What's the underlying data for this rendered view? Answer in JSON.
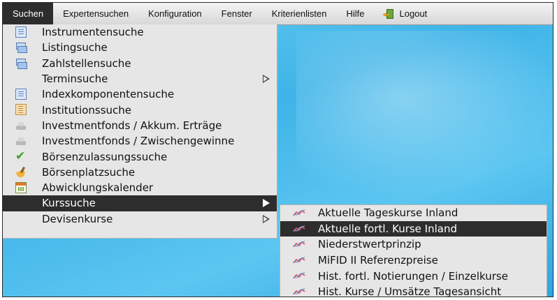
{
  "menubar": {
    "items": [
      {
        "label": "Suchen"
      },
      {
        "label": "Expertensuchen"
      },
      {
        "label": "Konfiguration"
      },
      {
        "label": "Fenster"
      },
      {
        "label": "Kriterienlisten"
      },
      {
        "label": "Hilfe"
      }
    ],
    "logout_label": "Logout"
  },
  "search_menu": {
    "items": [
      {
        "label": "Instrumentensuche",
        "icon": "document-list-icon"
      },
      {
        "label": "Listingsuche",
        "icon": "stacked-windows-icon"
      },
      {
        "label": "Zahlstellensuche",
        "icon": "stacked-windows-icon"
      },
      {
        "label": "Terminsuche",
        "icon": "",
        "submenu_arrow": "hollow"
      },
      {
        "label": "Indexkomponentensuche",
        "icon": "document-list-icon"
      },
      {
        "label": "Institutionssuche",
        "icon": "ledger-book-icon"
      },
      {
        "label": "Investmentfonds / Akkum. Erträge",
        "icon": "coin-pile-icon"
      },
      {
        "label": "Investmentfonds / Zwischengewinne",
        "icon": "coin-pile-icon"
      },
      {
        "label": "Börsenzulassungssuche",
        "icon": "checkmark-icon"
      },
      {
        "label": "Börsenplatzsuche",
        "icon": "broom-icon"
      },
      {
        "label": "Abwicklungskalender",
        "icon": "calendar-icon"
      },
      {
        "label": "Kurssuche",
        "icon": "",
        "submenu_arrow": "filled",
        "active": true
      },
      {
        "label": "Devisenkurse",
        "icon": "",
        "submenu_arrow": "hollow"
      }
    ]
  },
  "kurssuche_submenu": {
    "items": [
      {
        "label": "Aktuelle Tageskurse Inland",
        "icon": "price-chart-icon"
      },
      {
        "label": "Aktuelle fortl. Kurse Inland",
        "icon": "price-chart-icon",
        "active": true
      },
      {
        "label": "Niederstwertprinzip",
        "icon": "price-chart-icon"
      },
      {
        "label": "MiFID II Referenzpreise",
        "icon": "price-chart-icon"
      },
      {
        "label": "Hist. fortl. Notierungen / Einzelkurse",
        "icon": "price-chart-icon"
      },
      {
        "label": "Hist. Kurse / Umsätze Tagesansicht",
        "icon": "price-chart-icon"
      }
    ]
  },
  "colors": {
    "menu_bg": "#e6e6e6",
    "highlight_bg": "#2d2d2d",
    "desktop_blue": "#3fb4e8"
  }
}
